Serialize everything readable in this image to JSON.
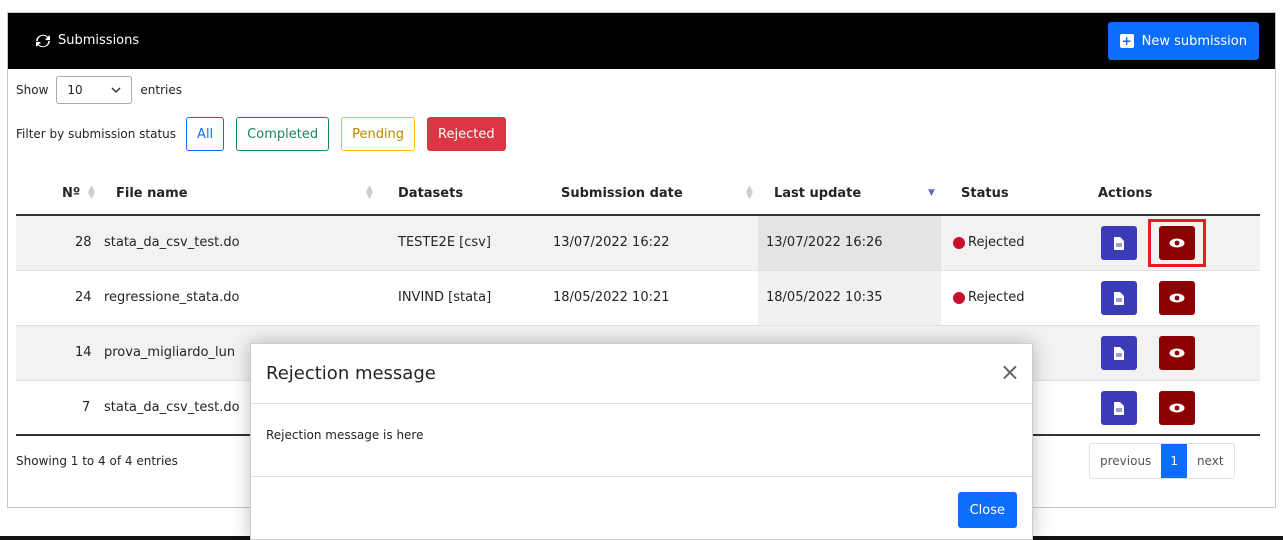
{
  "header": {
    "title": "Submissions",
    "new_submission_label": "New submission"
  },
  "length": {
    "show_label": "Show",
    "value": "10",
    "entries_label": "entries"
  },
  "filter": {
    "label": "Filter by submission status",
    "buttons": {
      "all": "All",
      "completed": "Completed",
      "pending": "Pending",
      "rejected": "Rejected"
    }
  },
  "table": {
    "columns": {
      "no": "Nº",
      "file_name": "File name",
      "datasets": "Datasets",
      "submission_date": "Submission date",
      "last_update": "Last update",
      "status": "Status",
      "actions": "Actions"
    },
    "rows": [
      {
        "no": "28",
        "file_name": "stata_da_csv_test.do",
        "datasets": "TESTE2E [csv]",
        "submission_date": "13/07/2022 16:22",
        "last_update": "13/07/2022 16:26",
        "status": "Rejected"
      },
      {
        "no": "24",
        "file_name": "regressione_stata.do",
        "datasets": "INVIND [stata]",
        "submission_date": "18/05/2022 10:21",
        "last_update": "18/05/2022 10:35",
        "status": "Rejected"
      },
      {
        "no": "14",
        "file_name": "prova_migliardo_lun"
      },
      {
        "no": "7",
        "file_name": "stata_da_csv_test.do"
      }
    ]
  },
  "footer": {
    "info": "Showing 1 to 4 of 4 entries"
  },
  "pagination": {
    "previous": "previous",
    "page": "1",
    "next": "next"
  },
  "modal": {
    "title": "Rejection message",
    "close_x": "×",
    "body": "Rejection message is here",
    "close_label": "Close"
  },
  "colors": {
    "primary": "#0d6efd",
    "rejected": "#dc3545",
    "action_view": "#8b0000",
    "action_doc": "#3b3bb8",
    "highlight": "#e02020"
  }
}
